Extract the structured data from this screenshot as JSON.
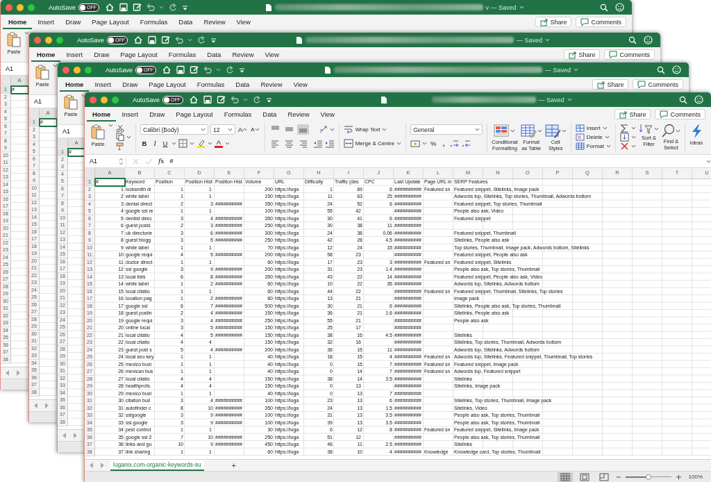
{
  "windows": [
    {
      "autosave": {
        "label": "AutoSave",
        "on": false,
        "state_label": "OFF"
      },
      "title": "v — Saved",
      "tabs": [
        {
          "label": "Home",
          "selected": true
        },
        {
          "label": "Insert",
          "selected": false
        },
        {
          "label": "Draw",
          "selected": false
        },
        {
          "label": "Page Layout",
          "selected": false
        },
        {
          "label": "Formulas",
          "selected": false
        },
        {
          "label": "Data",
          "selected": false
        },
        {
          "label": "Review",
          "selected": false
        },
        {
          "label": "View",
          "selected": false
        }
      ],
      "share": "Share",
      "comments": "Comments",
      "ribbon": {
        "paste": "Paste"
      },
      "formula_bar": {
        "name_box": "A1"
      },
      "grid": {
        "columns": [
          {
            "label": "A",
            "selected": true
          }
        ],
        "rows": [
          {
            "header": "1",
            "selected": true,
            "cells": [
              "#"
            ]
          },
          {
            "header": "2",
            "selected": false
          },
          {
            "header": "3",
            "selected": false
          },
          {
            "header": "4",
            "selected": false
          },
          {
            "header": "5",
            "selected": false
          },
          {
            "header": "6",
            "selected": false
          },
          {
            "header": "7",
            "selected": false
          },
          {
            "header": "8",
            "selected": false
          },
          {
            "header": "9",
            "selected": false
          },
          {
            "header": "10",
            "selected": false
          },
          {
            "header": "11",
            "selected": false
          },
          {
            "header": "12",
            "selected": false
          },
          {
            "header": "13",
            "selected": false
          },
          {
            "header": "14",
            "selected": false
          },
          {
            "header": "15",
            "selected": false
          },
          {
            "header": "16",
            "selected": false
          },
          {
            "header": "17",
            "selected": false
          },
          {
            "header": "18",
            "selected": false
          },
          {
            "header": "19",
            "selected": false
          },
          {
            "header": "20",
            "selected": false
          },
          {
            "header": "21",
            "selected": false
          },
          {
            "header": "22",
            "selected": false
          },
          {
            "header": "23",
            "selected": false
          },
          {
            "header": "24",
            "selected": false
          },
          {
            "header": "25",
            "selected": false
          },
          {
            "header": "26",
            "selected": false
          },
          {
            "header": "27",
            "selected": false
          },
          {
            "header": "28",
            "selected": false
          },
          {
            "header": "29",
            "selected": false
          },
          {
            "header": "30",
            "selected": false
          },
          {
            "header": "31",
            "selected": false
          },
          {
            "header": "32",
            "selected": false
          },
          {
            "header": "33",
            "selected": false
          },
          {
            "header": "34",
            "selected": false
          },
          {
            "header": "35",
            "selected": false
          },
          {
            "header": "36",
            "selected": false
          },
          {
            "header": "37",
            "selected": false
          },
          {
            "header": "38",
            "selected": false
          }
        ]
      }
    },
    {
      "autosave": {
        "label": "AutoSave",
        "on": false,
        "state_label": "OFF"
      },
      "title": "— Saved",
      "tabs": [
        {
          "label": "Home",
          "selected": true
        },
        {
          "label": "Insert",
          "selected": false
        },
        {
          "label": "Draw",
          "selected": false
        },
        {
          "label": "Page Layout",
          "selected": false
        },
        {
          "label": "Formulas",
          "selected": false
        },
        {
          "label": "Data",
          "selected": false
        },
        {
          "label": "Review",
          "selected": false
        },
        {
          "label": "View",
          "selected": false
        }
      ],
      "share": "Share",
      "comments": "Comments",
      "ribbon": {
        "paste": "Paste"
      },
      "formula_bar": {
        "name_box": "A1"
      },
      "grid": {
        "columns": [
          {
            "label": "A",
            "selected": true
          }
        ],
        "rows": [
          {
            "header": "1",
            "selected": true,
            "cells": [
              "#"
            ]
          },
          {
            "header": "2",
            "selected": false
          },
          {
            "header": "3",
            "selected": false
          },
          {
            "header": "4",
            "selected": false
          },
          {
            "header": "5",
            "selected": false
          },
          {
            "header": "6",
            "selected": false
          },
          {
            "header": "7",
            "selected": false
          },
          {
            "header": "8",
            "selected": false
          },
          {
            "header": "9",
            "selected": false
          },
          {
            "header": "10",
            "selected": false
          },
          {
            "header": "11",
            "selected": false
          },
          {
            "header": "12",
            "selected": false
          },
          {
            "header": "13",
            "selected": false
          },
          {
            "header": "14",
            "selected": false
          },
          {
            "header": "15",
            "selected": false
          },
          {
            "header": "16",
            "selected": false
          },
          {
            "header": "17",
            "selected": false
          },
          {
            "header": "18",
            "selected": false
          },
          {
            "header": "19",
            "selected": false
          },
          {
            "header": "20",
            "selected": false
          },
          {
            "header": "21",
            "selected": false
          },
          {
            "header": "22",
            "selected": false
          },
          {
            "header": "23",
            "selected": false
          },
          {
            "header": "24",
            "selected": false
          },
          {
            "header": "25",
            "selected": false
          },
          {
            "header": "26",
            "selected": false
          },
          {
            "header": "27",
            "selected": false
          },
          {
            "header": "28",
            "selected": false
          },
          {
            "header": "29",
            "selected": false
          },
          {
            "header": "30",
            "selected": false
          },
          {
            "header": "31",
            "selected": false
          },
          {
            "header": "32",
            "selected": false
          },
          {
            "header": "33",
            "selected": false
          },
          {
            "header": "34",
            "selected": false
          },
          {
            "header": "35",
            "selected": false
          },
          {
            "header": "36",
            "selected": false
          },
          {
            "header": "37",
            "selected": false
          },
          {
            "header": "38",
            "selected": false
          }
        ]
      }
    },
    {
      "autosave": {
        "label": "AutoSave",
        "on": false,
        "state_label": "OFF"
      },
      "title": "— Saved",
      "tabs": [
        {
          "label": "Home",
          "selected": true
        },
        {
          "label": "Insert",
          "selected": false
        },
        {
          "label": "Draw",
          "selected": false
        },
        {
          "label": "Page Layout",
          "selected": false
        },
        {
          "label": "Formulas",
          "selected": false
        },
        {
          "label": "Data",
          "selected": false
        },
        {
          "label": "Review",
          "selected": false
        },
        {
          "label": "View",
          "selected": false
        }
      ],
      "share": "Share",
      "comments": "Comments",
      "ribbon": {
        "paste": "Paste"
      },
      "formula_bar": {
        "name_box": "A1"
      },
      "grid": {
        "columns": [
          {
            "label": "A",
            "selected": true
          }
        ],
        "rows": [
          {
            "header": "1",
            "selected": true,
            "cells": [
              "#"
            ]
          },
          {
            "header": "2",
            "selected": false
          },
          {
            "header": "3",
            "selected": false
          },
          {
            "header": "4",
            "selected": false
          },
          {
            "header": "5",
            "selected": false
          },
          {
            "header": "6",
            "selected": false
          },
          {
            "header": "7",
            "selected": false
          },
          {
            "header": "8",
            "selected": false
          },
          {
            "header": "9",
            "selected": false
          },
          {
            "header": "10",
            "selected": false
          },
          {
            "header": "11",
            "selected": false
          },
          {
            "header": "12",
            "selected": false
          },
          {
            "header": "13",
            "selected": false
          },
          {
            "header": "14",
            "selected": false
          },
          {
            "header": "15",
            "selected": false
          },
          {
            "header": "16",
            "selected": false
          },
          {
            "header": "17",
            "selected": false
          },
          {
            "header": "18",
            "selected": false
          },
          {
            "header": "19",
            "selected": false
          },
          {
            "header": "20",
            "selected": false
          },
          {
            "header": "21",
            "selected": false
          },
          {
            "header": "22",
            "selected": false
          },
          {
            "header": "23",
            "selected": false
          },
          {
            "header": "24",
            "selected": false
          },
          {
            "header": "25",
            "selected": false
          },
          {
            "header": "26",
            "selected": false
          },
          {
            "header": "27",
            "selected": false
          },
          {
            "header": "28",
            "selected": false
          },
          {
            "header": "29",
            "selected": false
          },
          {
            "header": "30",
            "selected": false
          },
          {
            "header": "31",
            "selected": false
          },
          {
            "header": "32",
            "selected": false
          },
          {
            "header": "33",
            "selected": false
          },
          {
            "header": "34",
            "selected": false
          },
          {
            "header": "35",
            "selected": false
          },
          {
            "header": "36",
            "selected": false
          },
          {
            "header": "37",
            "selected": false
          },
          {
            "header": "38",
            "selected": false
          }
        ]
      }
    },
    {
      "autosave": {
        "label": "AutoSave",
        "on": false,
        "state_label": "OFF"
      },
      "title": "— Saved",
      "tabs": [
        {
          "label": "Home",
          "selected": true
        },
        {
          "label": "Insert",
          "selected": false
        },
        {
          "label": "Draw",
          "selected": false
        },
        {
          "label": "Page Layout",
          "selected": false
        },
        {
          "label": "Formulas",
          "selected": false
        },
        {
          "label": "Data",
          "selected": false
        },
        {
          "label": "Review",
          "selected": false
        },
        {
          "label": "View",
          "selected": false
        }
      ],
      "share": "Share",
      "comments": "Comments",
      "ribbon": {
        "paste": "Paste",
        "font": "Calibri (Body)",
        "font_size": "12",
        "grow_font": "A",
        "shrink_font": "A",
        "bold": "B",
        "italic": "I",
        "underline": "U",
        "font_color": "A",
        "vertical_align": [
          {
            "kind": "top",
            "selected": false
          },
          {
            "kind": "middle",
            "selected": false
          },
          {
            "kind": "bottom",
            "selected": true
          }
        ],
        "horizontal_align": [
          {
            "kind": "left",
            "selected": false
          },
          {
            "kind": "center",
            "selected": false
          },
          {
            "kind": "right",
            "selected": false
          }
        ],
        "wrap_text": "Wrap Text",
        "merge": "Merge & Centre",
        "number_format": "General",
        "percent": "%",
        "comma": ",",
        "style_buttons": [
          {
            "kind": "conditional",
            "lines": [
              "Conditional",
              "Formatting"
            ]
          },
          {
            "kind": "table",
            "lines": [
              "Format",
              "as Table"
            ]
          },
          {
            "kind": "styles",
            "lines": [
              "Cell",
              "Styles"
            ]
          }
        ],
        "cell_buttons": [
          {
            "kind": "insert",
            "label": "Insert"
          },
          {
            "kind": "delete",
            "label": "Delete"
          },
          {
            "kind": "format",
            "label": "Format"
          }
        ],
        "sort_filter": [
          "Sort &",
          "Filter"
        ],
        "find_select": [
          "Find &",
          "Select"
        ],
        "ideas": "Ideas"
      },
      "formula_bar": {
        "name_box": "A1",
        "function": "fx",
        "content": "#"
      },
      "grid": {
        "columns": [
          {
            "label": "A",
            "selected": true
          },
          {
            "label": "B",
            "selected": false
          },
          {
            "label": "C",
            "selected": false
          },
          {
            "label": "D",
            "selected": false
          },
          {
            "label": "E",
            "selected": false
          },
          {
            "label": "F",
            "selected": false
          },
          {
            "label": "G",
            "selected": false
          },
          {
            "label": "H",
            "selected": false
          },
          {
            "label": "I",
            "selected": false
          },
          {
            "label": "J",
            "selected": false
          },
          {
            "label": "K",
            "selected": false
          },
          {
            "label": "L",
            "selected": false
          },
          {
            "label": "M",
            "selected": false
          },
          {
            "label": "N",
            "selected": false
          },
          {
            "label": "O",
            "selected": false
          },
          {
            "label": "P",
            "selected": false
          },
          {
            "label": "Q",
            "selected": false
          },
          {
            "label": "R",
            "selected": false
          },
          {
            "label": "S",
            "selected": false
          },
          {
            "label": "T",
            "selected": false
          },
          {
            "label": "U",
            "selected": false
          }
        ],
        "rows": [
          {
            "header": "1",
            "selected": true,
            "cells": [
              "#",
              "Keyword",
              "Position",
              "Position Hist",
              "Position Hist",
              "Volume",
              "URL",
              "Difficulty",
              "Traffic (des",
              "CPC",
              "Last Update",
              "Page URL in",
              "SERP Features"
            ]
          },
          {
            "header": "2",
            "selected": false,
            "cells": [
              "1",
              "locksmith di",
              "1",
              "1",
              null,
              "200",
              "https://loga",
              "1",
              "69",
              "6",
              "##########",
              "Featured sn",
              "Featured snippet, Sitelinks, Image pack"
            ]
          },
          {
            "header": "3",
            "selected": false,
            "cells": [
              "2",
              "white label",
              "1",
              "1",
              null,
              "150",
              "https://loga",
              "11",
              "63",
              "25",
              "##########",
              null,
              "Adwords top, Sitelinks, Top stories, Thumbnail, Adwords bottom"
            ]
          },
          {
            "header": "4",
            "selected": false,
            "cells": [
              "3",
              "dental direct",
              "2",
              "3",
              "##########",
              "350",
              "https://loga",
              "24",
              "52",
              "6",
              "##########",
              null,
              "Featured snippet, Top stories, Thumbnail"
            ]
          },
          {
            "header": "5",
            "selected": false,
            "cells": [
              "4",
              "google ssl re",
              "1",
              "1",
              null,
              "100",
              "https://loga",
              "55",
              "42",
              null,
              "##########",
              null,
              "People also ask, Video"
            ]
          },
          {
            "header": "6",
            "selected": false,
            "cells": [
              "5",
              "dentist direc",
              "3",
              "4",
              "##########",
              "350",
              "https://loga",
              "30",
              "41",
              "6",
              "##########",
              null,
              "Featured snippet"
            ]
          },
          {
            "header": "7",
            "selected": false,
            "cells": [
              "6",
              "guest posts",
              "2",
              "3",
              "##########",
              "250",
              "https://loga",
              "30",
              "38",
              "11",
              "##########"
            ]
          },
          {
            "header": "8",
            "selected": false,
            "cells": [
              "7",
              "uk directorie",
              "3",
              "6",
              "##########",
              "300",
              "https://loga",
              "24",
              "38",
              "0.06",
              "##########",
              null,
              "Featured snippet, Thumbnail"
            ]
          },
          {
            "header": "9",
            "selected": false,
            "cells": [
              "8",
              "guest blogg",
              "3",
              "5",
              "##########",
              "250",
              "https://loga",
              "42",
              "28",
              "4.5",
              "##########",
              null,
              "Sitelinks, People also ask"
            ]
          },
          {
            "header": "10",
            "selected": false,
            "cells": [
              "9",
              "white label",
              "1",
              "1",
              null,
              "70",
              "https://loga",
              "12",
              "24",
              "15",
              "##########",
              null,
              "Top stories, Thumbnail, Image pack, Adwords bottom, Sitelinks"
            ]
          },
          {
            "header": "11",
            "selected": false,
            "cells": [
              "10",
              "google requi",
              "4",
              "5",
              "##########",
              "200",
              "https://loga",
              "58",
              "23",
              null,
              "##########",
              null,
              "Featured snippet, People also ask"
            ]
          },
          {
            "header": "12",
            "selected": false,
            "cells": [
              "11",
              "doctor direct",
              "1",
              "1",
              null,
              "60",
              "https://loga",
              "17",
              "23",
              "3",
              "##########",
              "Featured sn",
              "Featured snippet, Sitelinks"
            ]
          },
          {
            "header": "13",
            "selected": false,
            "cells": [
              "12",
              "ssl google",
              "3",
              "9",
              "##########",
              "200",
              "https://loga",
              "31",
              "23",
              "1.4",
              "##########",
              null,
              "People also ask, Top stories, Thumbnail"
            ]
          },
          {
            "header": "14",
            "selected": false,
            "cells": [
              "13",
              "local lists",
              "6",
              "8",
              "##########",
              "350",
              "https://loga",
              "43",
              "22",
              "14",
              "##########",
              null,
              "Featured snippet, People also ask, Video"
            ]
          },
          {
            "header": "15",
            "selected": false,
            "cells": [
              "14",
              "white label",
              "1",
              "2",
              "##########",
              "60",
              "https://loga",
              "10",
              "22",
              "35",
              "##########",
              null,
              "Adwords top, Sitelinks, Adwords bottom"
            ]
          },
          {
            "header": "16",
            "selected": false,
            "cells": [
              "15",
              "local citatio",
              "1",
              "1",
              null,
              "60",
              "https://loga",
              "44",
              "22",
              null,
              "##########",
              "Featured sn",
              "Featured snippet, Thumbnail, Sitelinks, Top stories"
            ]
          },
          {
            "header": "17",
            "selected": false,
            "cells": [
              "16",
              "location pag",
              "1",
              "2",
              "##########",
              "60",
              "https://loga",
              "13",
              "21",
              null,
              "##########",
              null,
              "Image pack"
            ]
          },
          {
            "header": "18",
            "selected": false,
            "cells": [
              "17",
              "google ssl",
              "6",
              "7",
              "##########",
              "500",
              "https://loga",
              "30",
              "21",
              "6",
              "##########",
              null,
              "Sitelinks, People also ask, Top stories, Thumbnail"
            ]
          },
          {
            "header": "19",
            "selected": false,
            "cells": [
              "18",
              "guest postin",
              "2",
              "4",
              "##########",
              "150",
              "https://loga",
              "36",
              "21",
              "1.6",
              "##########",
              null,
              "Sitelinks, People also ask"
            ]
          },
          {
            "header": "20",
            "selected": false,
            "cells": [
              "19",
              "google requi",
              "3",
              "4",
              "##########",
              "250",
              "https://loga",
              "55",
              "21",
              null,
              "##########",
              null,
              "People also ask"
            ]
          },
          {
            "header": "21",
            "selected": false,
            "cells": [
              "20",
              "online local",
              "3",
              "5",
              "##########",
              "150",
              "https://loga",
              "25",
              "17",
              null,
              "##########"
            ]
          },
          {
            "header": "22",
            "selected": false,
            "cells": [
              "21",
              "local citatio",
              "4",
              "5",
              "##########",
              "150",
              "https://loga",
              "38",
              "16",
              "4.5",
              "##########",
              null,
              "Sitelinks"
            ]
          },
          {
            "header": "23",
            "selected": false,
            "cells": [
              "22",
              "local citatio",
              "4",
              "4",
              null,
              "150",
              "https://loga",
              "32",
              "16",
              null,
              "##########",
              null,
              "Sitelinks, Top stories, Thumbnail, Adwords bottom"
            ]
          },
          {
            "header": "24",
            "selected": false,
            "cells": [
              "23",
              "guest post s",
              "5",
              "4",
              "##########",
              "200",
              "https://loga",
              "36",
              "15",
              "11",
              "##########",
              null,
              "Adwords top, Sitelinks, Adwords bottom"
            ]
          },
          {
            "header": "25",
            "selected": false,
            "cells": [
              "24",
              "local seo key",
              "1",
              "1",
              null,
              "40",
              "https://loga",
              "18",
              "15",
              "4",
              "##########",
              "Featured sn",
              "Adwords top, Sitelinks, Featured snippet, Thumbnail, Top stories"
            ]
          },
          {
            "header": "26",
            "selected": false,
            "cells": [
              "25",
              "mexico busi",
              "1",
              "1",
              null,
              "40",
              "https://loga",
              "0",
              "15",
              "7",
              "##########",
              "Featured sn",
              "Featured snippet, Image pack"
            ]
          },
          {
            "header": "27",
            "selected": false,
            "cells": [
              "26",
              "mexican bus",
              "1",
              "1",
              null,
              "40",
              "https://loga",
              "0",
              "14",
              "7",
              "##########",
              "Featured sn",
              "Adwords top, Featured snippet"
            ]
          },
          {
            "header": "28",
            "selected": false,
            "cells": [
              "27",
              "local citatio",
              "4",
              "4",
              null,
              "150",
              "https://loga",
              "38",
              "14",
              "3.5",
              "##########",
              null,
              "Sitelinks"
            ]
          },
          {
            "header": "29",
            "selected": false,
            "cells": [
              "28",
              "healthprofs.",
              "4",
              "4",
              null,
              "150",
              "https://loga",
              "0",
              "13",
              null,
              "##########",
              null,
              "Sitelinks, Image pack"
            ]
          },
          {
            "header": "30",
            "selected": false,
            "cells": [
              "29",
              "mexico busi",
              "1",
              "1",
              null,
              "40",
              "https://loga",
              "0",
              "13",
              "7",
              "##########"
            ]
          },
          {
            "header": "31",
            "selected": false,
            "cells": [
              "30",
              "citation buil",
              "3",
              "4",
              "##########",
              "100",
              "https://loga",
              "23",
              "13",
              "6",
              "##########",
              null,
              "Sitelinks, Top stories, Thumbnail, Image pack"
            ]
          },
          {
            "header": "32",
            "selected": false,
            "cells": [
              "31",
              "autofinder c",
              "8",
              "10",
              "##########",
              "350",
              "https://loga",
              "24",
              "13",
              "1.5",
              "##########",
              null,
              "Sitelinks, Video"
            ]
          },
          {
            "header": "33",
            "selected": false,
            "cells": [
              "32",
              "sslgoogle",
              "3",
              "9",
              "##########",
              "100",
              "https://loga",
              "31",
              "13",
              "3.5",
              "##########",
              null,
              "People also ask, Top stories, Thumbnail"
            ]
          },
          {
            "header": "34",
            "selected": false,
            "cells": [
              "33",
              "ssl.google",
              "3",
              "9",
              "##########",
              "100",
              "https://loga",
              "39",
              "13",
              "3.5",
              "##########",
              null,
              "People also ask, Top stories, Thumbnail"
            ]
          },
          {
            "header": "35",
            "selected": false,
            "cells": [
              "34",
              "pest control",
              "1",
              "1",
              null,
              "30",
              "https://loga",
              "6",
              "12",
              "8",
              "##########",
              "Featured sn",
              "Featured snippet, Sitelinks, Image pack"
            ]
          },
          {
            "header": "36",
            "selected": false,
            "cells": [
              "35",
              "google ssl 2",
              "7",
              "10",
              "##########",
              "250",
              "https://loga",
              "51",
              "12",
              null,
              "##########",
              null,
              "People also ask, Top stories, Thumbnail"
            ]
          },
          {
            "header": "37",
            "selected": false,
            "cells": [
              "36",
              "links and gu",
              "10",
              "9",
              "##########",
              "450",
              "https://loga",
              "46",
              "11",
              "2.5",
              "##########",
              null,
              "Sitelinks"
            ]
          },
          {
            "header": "38",
            "selected": false,
            "cells": [
              "37",
              "link sharing",
              "1",
              "1",
              null,
              "60",
              "https://loga",
              "38",
              "10",
              "4",
              "##########",
              "Knowledge",
              "Knowledge card, Top stories, Thumbnail"
            ]
          }
        ]
      },
      "sheet_tabs": [
        {
          "label": "loganix.com-organic-keywords-su",
          "selected": true
        }
      ],
      "add_sheet": "+",
      "status": {
        "views": [
          {
            "kind": "normal",
            "selected": true
          },
          {
            "kind": "layout",
            "selected": false
          },
          {
            "kind": "break",
            "selected": false
          }
        ],
        "zoom_slider": {
          "level": 0.5
        },
        "zoom": "100%"
      }
    }
  ]
}
